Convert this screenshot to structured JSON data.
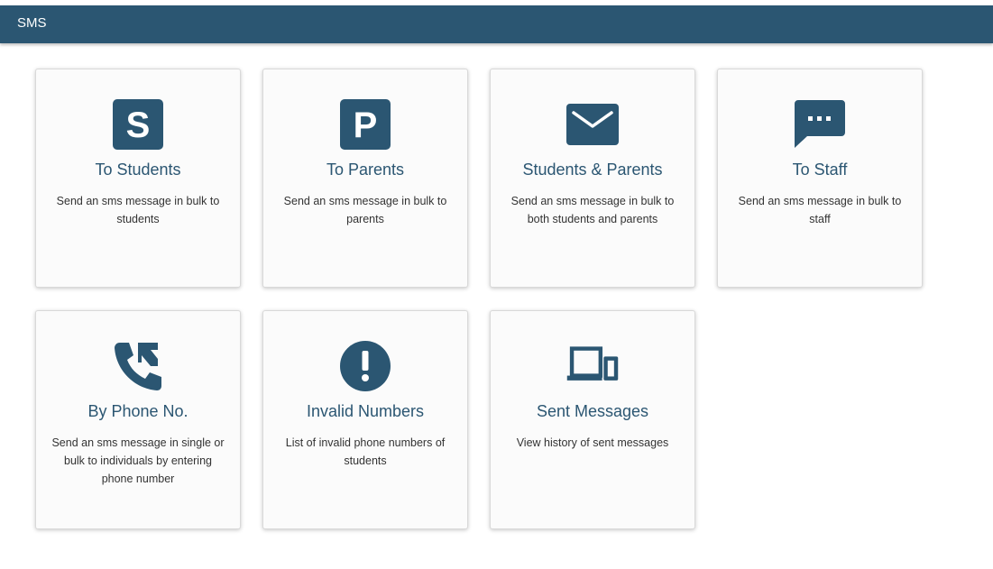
{
  "header": {
    "title": "SMS"
  },
  "colors": {
    "accent": "#2b5672",
    "header_bg": "#2b5672",
    "card_bg": "#fbfbfb"
  },
  "cards": [
    {
      "icon": "letter-s-icon",
      "title": "To Students",
      "description": "Send an sms message in bulk to students"
    },
    {
      "icon": "letter-p-icon",
      "title": "To Parents",
      "description": "Send an sms message in bulk to parents"
    },
    {
      "icon": "envelope-icon",
      "title": "Students & Parents",
      "description": "Send an sms message in bulk to both students and parents"
    },
    {
      "icon": "chat-bubble-icon",
      "title": "To Staff",
      "description": "Send an sms message in bulk to staff"
    },
    {
      "icon": "phone-forward-icon",
      "title": "By Phone No.",
      "description": "Send an sms message in single or bulk to individuals by entering phone number"
    },
    {
      "icon": "exclamation-circle-icon",
      "title": "Invalid Numbers",
      "description": "List of invalid phone numbers of students"
    },
    {
      "icon": "devices-icon",
      "title": "Sent Messages",
      "description": "View history of sent messages"
    }
  ]
}
